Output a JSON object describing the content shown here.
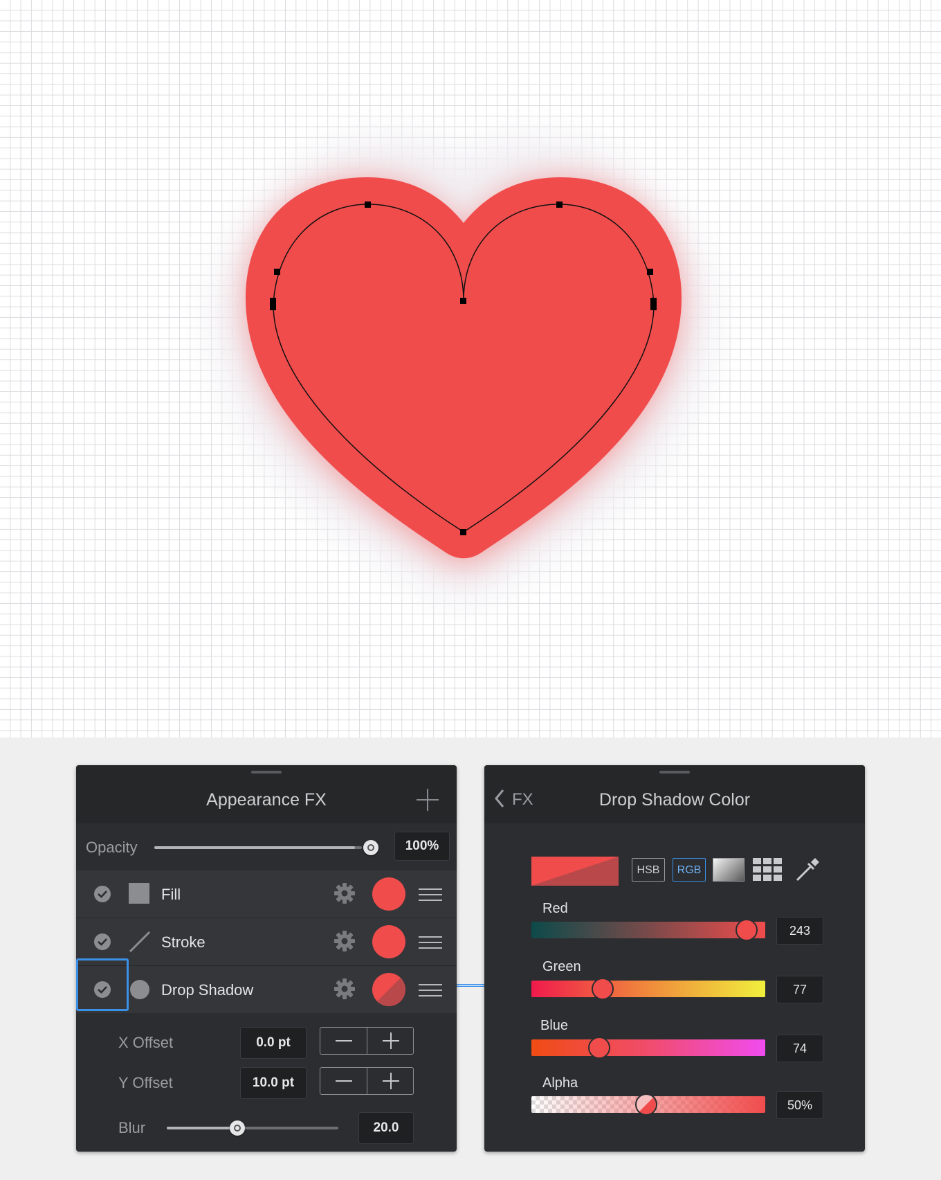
{
  "canvas": {
    "shape": "heart",
    "fill_color": "#f04c4c",
    "shadow_color": "#f04c4c"
  },
  "appearance_panel": {
    "title": "Appearance FX",
    "add_icon": "plus-icon",
    "opacity": {
      "label": "Opacity",
      "value": "100%",
      "level": 1.0
    },
    "layers": [
      {
        "name": "Fill",
        "enabled": true,
        "color": "#f04c4c"
      },
      {
        "name": "Stroke",
        "enabled": true,
        "color": "#f04c4c"
      },
      {
        "name": "Drop Shadow",
        "enabled": true,
        "color": "#f04c4c",
        "selected": true
      }
    ],
    "x_offset": {
      "label": "X Offset",
      "value": "0.0 pt"
    },
    "y_offset": {
      "label": "Y Offset",
      "value": "10.0 pt"
    },
    "blur": {
      "label": "Blur",
      "value": "20.0",
      "level": 0.42
    }
  },
  "color_panel": {
    "back_label": "FX",
    "title": "Drop Shadow Color",
    "modes": [
      "HSB",
      "RGB"
    ],
    "active_mode": "RGB",
    "preview_color": "#f04c4c",
    "channels": [
      {
        "label": "Red",
        "value": "243",
        "level": 0.953
      },
      {
        "label": "Green",
        "value": "77",
        "level": 0.302
      },
      {
        "label": "Blue",
        "value": "74",
        "level": 0.29
      },
      {
        "label": "Alpha",
        "value": "50%",
        "level": 0.5
      }
    ]
  }
}
